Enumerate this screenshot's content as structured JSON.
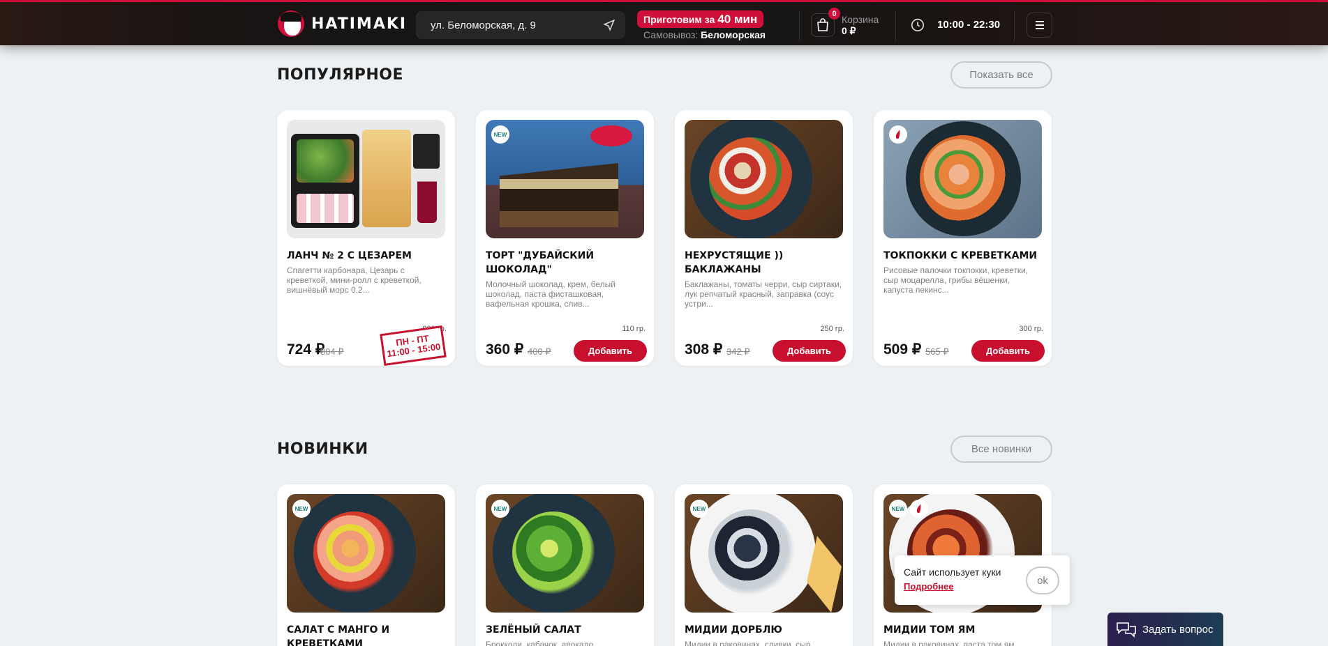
{
  "header": {
    "logo_text": "HATIMAKI",
    "address": "ул. Беломорская, д. 9",
    "cook_prefix": "Приготовим за",
    "cook_time": "40 мин",
    "pickup_label": "Самовывоз:",
    "pickup_value": "Беломорская",
    "cart_count": "0",
    "cart_label": "Корзина",
    "cart_sum": "0 ₽",
    "hours": "10:00 - 22:30"
  },
  "popular": {
    "title": "ПОПУЛЯРНОЕ",
    "show_all": "Показать все",
    "items": [
      {
        "name": "ЛАНЧ № 2 С ЦЕЗАРЕМ",
        "desc": "Спагетти карбонара, Цезарь с креветкой, мини-ролл с креветкой, вишнёвый морс 0.2...",
        "weight": "900 гр.",
        "price": "724 ₽",
        "old_price": "804 ₽",
        "stamp_days": "ПН - ПТ",
        "stamp_hours": "11:00 - 15:00"
      },
      {
        "name": "ТОРТ \"ДУБАЙСКИЙ ШОКОЛАД\"",
        "desc": "Молочный шоколад, крем, белый шоколад, паста фисташковая, вафельная крошка, слив...",
        "weight": "110 гр.",
        "price": "360 ₽",
        "old_price": "400 ₽",
        "button": "Добавить",
        "badge": "NEW"
      },
      {
        "name": "НЕХРУСТЯЩИЕ )) БАКЛАЖАНЫ",
        "desc": "Баклажаны, томаты черри, сыр сиртаки, лук репчатый красный, заправка (соус устри...",
        "weight": "250 гр.",
        "price": "308 ₽",
        "old_price": "342 ₽",
        "button": "Добавить"
      },
      {
        "name": "ТОКПОККИ С КРЕВЕТКАМИ",
        "desc": "Рисовые палочки токпокки, креветки, сыр моцарелла, грибы вёшенки, капуста пекинс...",
        "weight": "300 гр.",
        "price": "509 ₽",
        "old_price": "565 ₽",
        "button": "Добавить"
      }
    ]
  },
  "new_items": {
    "title": "НОВИНКИ",
    "show_all": "Все новинки",
    "items": [
      {
        "name": "САЛАТ С МАНГО И КРЕВЕТКАМИ",
        "badge": "NEW"
      },
      {
        "name": "ЗЕЛЁНЫЙ САЛАТ",
        "desc": "Брокколи, кабачок, авокадо...",
        "badge": "NEW"
      },
      {
        "name": "МИДИИ ДОРБЛЮ",
        "desc": "Мидии в раковинах, сливки, сыр...",
        "badge": "NEW"
      },
      {
        "name": "МИДИИ ТОМ ЯМ",
        "desc": "Мидии в раковинах, паста том ям...",
        "badge": "NEW"
      }
    ]
  },
  "cookie": {
    "text": "Сайт использует куки",
    "link": "Подробнее",
    "ok": "ok"
  },
  "chat": {
    "label": "Задать вопрос"
  }
}
